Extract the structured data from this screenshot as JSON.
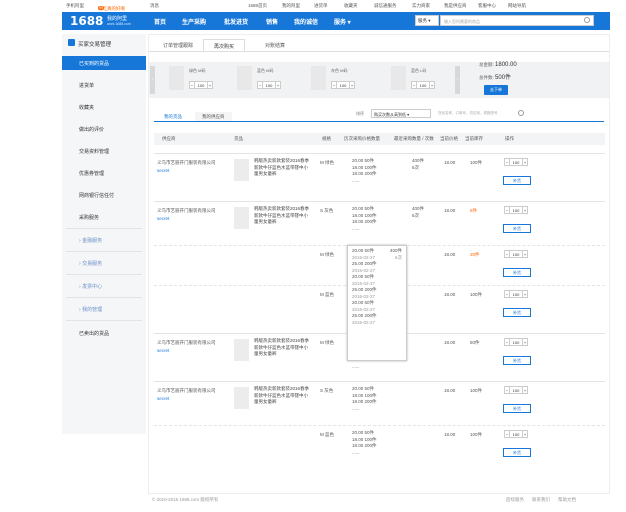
{
  "topbar": {
    "mobile": "手机阿里",
    "user": "好吃真的好啊",
    "count": "99",
    "msg": "消息",
    "home": "1688首页",
    "my1688": "我的阿里",
    "purchase": "进货单",
    "fav": "收藏夹",
    "member": "诚信通服务",
    "power": "实力商家",
    "buyer": "我是供应商",
    "service": "客服中心",
    "nav": "网站导航"
  },
  "nav": {
    "logo": "1688",
    "site_title": "我的阿里",
    "site_url": "work.1688.com",
    "items": [
      "首页",
      "生产采购",
      "批发进货",
      "销售",
      "我的诚信",
      "服务"
    ],
    "select": "服务",
    "search_placeholder": "输入您所需要的商品"
  },
  "sidebar": {
    "header": "买家交易管理",
    "items": [
      "已买到的货品",
      "进货单",
      "收藏夹",
      "做出的评价",
      "交易资料管理",
      "优惠券管理",
      "网商银行信任付",
      "采购服务"
    ],
    "groups": [
      "金融服务",
      "交易服务",
      "发票中心",
      "我的管理"
    ],
    "last": "已卖出的货品"
  },
  "main": {
    "tabs": [
      "订单管理跟踪",
      "再次购买",
      "对账结算"
    ],
    "carousel": [
      {
        "spec": "绿色  M码",
        "qty": "100"
      },
      {
        "spec": "蓝色  M码",
        "qty": "100"
      },
      {
        "spec": "灰色  M码",
        "qty": "100"
      },
      {
        "spec": "蓝色  L码",
        "qty": "100"
      }
    ],
    "summary": {
      "amount_label": "总金额:",
      "amount": "1800.00",
      "count_label": "总件数:",
      "count": "500件",
      "btn": "去下单"
    },
    "subtabs": [
      "我的货品",
      "我的供应商"
    ],
    "sort_label": "排序",
    "sort_value": "购买次数从高到低",
    "filter_placeholder": "货品名称，订单号，供应商，规格型号",
    "headers": [
      "供应商",
      "货品",
      "规格",
      "历次采购价格数量",
      "最近采购数量 / 次数",
      "当前价格",
      "当前库存",
      "操作"
    ],
    "rows": [
      {
        "supplier": "义乌市艺丽开门服装有限公司",
        "secret": "secret",
        "name": "韩版热卖新款套装2016春季新款牛仔蓝色水蓝带镂中小童男女童裤",
        "spec": "M 绿色",
        "hist": [
          "20.00    50件",
          "18.00    100件",
          "18.00    200件",
          "......"
        ],
        "sup": [
          "400件",
          "6次"
        ],
        "price": "18.00",
        "stock": "100件",
        "qty": "100",
        "btn": "补货"
      },
      {
        "supplier": "义乌市艺丽开门服装有限公司",
        "secret": "secret",
        "name": "韩版热卖新款套装2016春季新款牛仔蓝色水蓝带镂中小童男女童裤",
        "spec": "S 灰色",
        "hist": [
          "20.00    50件",
          "18.00    100件",
          "18.00    200件",
          "......"
        ],
        "sup": [
          "400件",
          "6次"
        ],
        "price": "18.00",
        "stock": "5件",
        "qty": "100",
        "btn": "补货"
      },
      {
        "spec": "M 绿色",
        "price": "18.00",
        "stock": "20件",
        "qty": "100",
        "btn": "补货"
      },
      {
        "spec": "M 蓝色",
        "price": "18.00",
        "stock": "100件",
        "qty": "100",
        "btn": "补货"
      },
      {
        "supplier": "义乌市艺丽开门服装有限公司",
        "secret": "secret",
        "name": "韩版热卖新款套装2016春季新款牛仔蓝色水蓝带镂中小童男女童裤",
        "spec": "M 绿色",
        "hist": [
          "20.00    50件",
          "18.00    100件",
          "18.00    200件",
          "......"
        ],
        "price": "18.00",
        "stock": "50件",
        "qty": "100",
        "btn": "补货"
      },
      {
        "supplier": "义乌市艺丽开门服装有限公司",
        "secret": "secret",
        "name": "韩版热卖新款套装2016春季新款牛仔蓝色水蓝带镂中小童男女童裤",
        "spec": "S 灰色",
        "hist": [
          "20.00    50件",
          "18.00    100件",
          "18.00    200件",
          "......"
        ],
        "price": "18.00",
        "stock": "100件",
        "qty": "100",
        "btn": "补货"
      },
      {
        "spec": "M 蓝色",
        "hist": [
          "20.00    50件",
          "18.00    100件",
          "18.00    200件",
          "......"
        ],
        "price": "18.00",
        "stock": "100件",
        "qty": "100",
        "btn": "补货"
      }
    ],
    "popup": [
      [
        "20.00    50件",
        "400件"
      ],
      [
        "2016-02-27",
        "6次"
      ],
      [
        "25.00    200件",
        ""
      ],
      [
        "2016-02-27",
        ""
      ],
      [
        "20.00    50件",
        ""
      ],
      [
        "2016-02-27",
        ""
      ],
      [
        "25.00    200件",
        ""
      ],
      [
        "2016-02-27",
        ""
      ],
      [
        "20.00    50件",
        ""
      ],
      [
        "2016-02-27",
        ""
      ],
      [
        "25.00    200件",
        ""
      ],
      [
        "2016-02-27",
        ""
      ]
    ]
  },
  "footer": {
    "copy": "© 2010-2016 1688.com 版权所有",
    "links": [
      "后续服务",
      "联系我们",
      "帮助文档"
    ]
  }
}
